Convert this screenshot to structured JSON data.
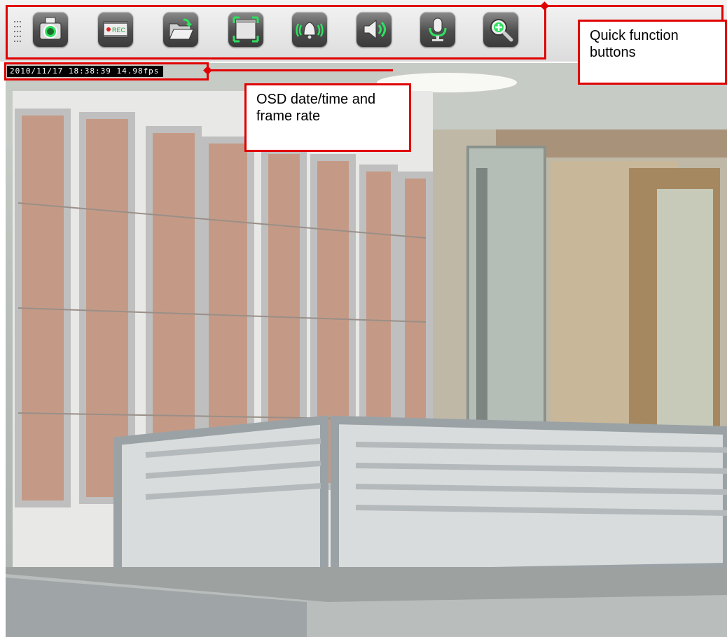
{
  "toolbar": {
    "buttons": [
      {
        "name": "snapshot-camera-icon"
      },
      {
        "name": "record-icon",
        "label": "REC"
      },
      {
        "name": "folder-icon"
      },
      {
        "name": "fullscreen-icon"
      },
      {
        "name": "alarm-bell-icon"
      },
      {
        "name": "speaker-icon"
      },
      {
        "name": "microphone-icon"
      },
      {
        "name": "zoom-in-icon"
      }
    ]
  },
  "osd": {
    "text": "2010/11/17 18:38:39 14.98fps"
  },
  "annotations": {
    "quick_function": "Quick function buttons",
    "osd_label": "OSD date/time and frame rate"
  },
  "colors": {
    "annotation": "#e00000",
    "icon_glow": "#2fe060",
    "button_bg": "#4e4e4e"
  }
}
